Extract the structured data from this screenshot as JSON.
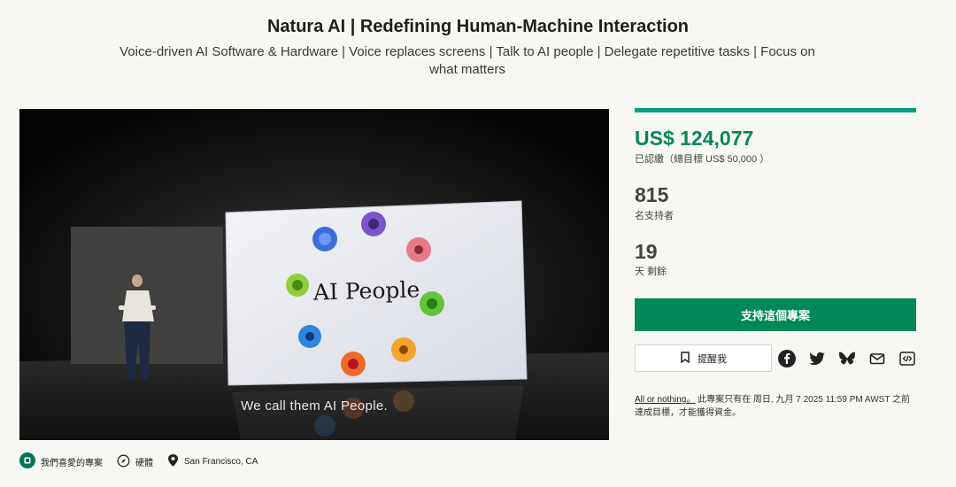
{
  "header": {
    "title": "Natura AI | Redefining Human-Machine Interaction",
    "subtitle": "Voice-driven AI Software & Hardware | Voice replaces screens | Talk to AI people | Delegate repetitive tasks | Focus on what matters"
  },
  "video": {
    "slide_text": "AI People",
    "caption": "We call them AI People."
  },
  "funding": {
    "progress_fraction": 1.0,
    "pledged": "US$ 124,077",
    "goal_text": "已認繳（總目標 US$ 50,000 ）",
    "backers_count": "815",
    "backers_label": "名支持者",
    "days_count": "19",
    "days_label": "天 剩餘"
  },
  "actions": {
    "back_label": "支持這個專案",
    "remind_label": "提醒我"
  },
  "share_icons": [
    "facebook-icon",
    "twitter-icon",
    "bluesky-icon",
    "email-icon",
    "embed-icon"
  ],
  "notice": {
    "link_text": "All or nothing。",
    "text": "此專案只有在 周日, 九月 7 2025 11:59 PM AWST 之前達成目標，才能獲得資金。"
  },
  "tags": {
    "favorite": "我們喜愛的專案",
    "hardware": "硬體",
    "location": "San Francisco, CA"
  },
  "colors": {
    "accent": "#028858",
    "progress": "#05a081"
  }
}
